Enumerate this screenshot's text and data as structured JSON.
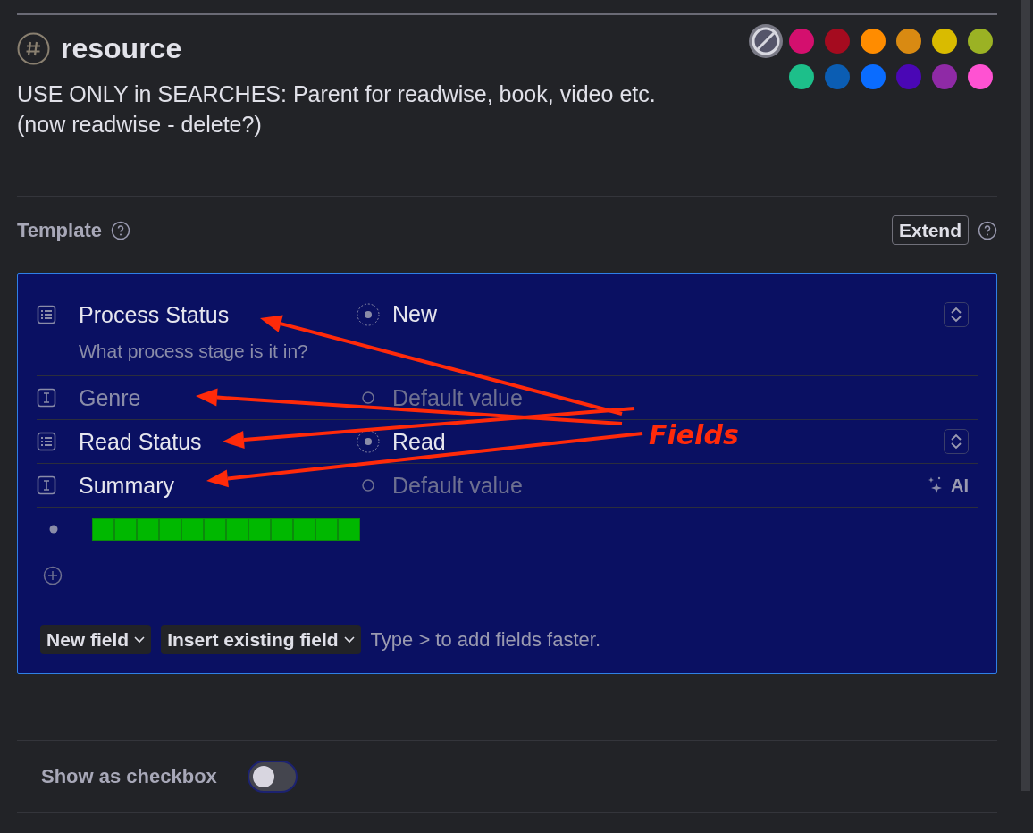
{
  "tag": {
    "name": "resource",
    "description_lines": [
      "USE ONLY in SEARCHES: Parent for readwise, book, video etc.",
      "(now readwise - delete?)"
    ]
  },
  "palette": {
    "no_color": {
      "selected": true
    },
    "colors": [
      {
        "color": "#d40f6e",
        "selected": false
      },
      {
        "color": "#a50b1f",
        "selected": false
      },
      {
        "color": "#ff8c00",
        "selected": false
      },
      {
        "color": "#d98a12",
        "selected": false
      },
      {
        "color": "#d9bb00",
        "selected": false
      },
      {
        "color": "#9bb224",
        "selected": false
      },
      {
        "color": "#1dbf8a",
        "selected": false
      },
      {
        "color": "#0b5db3",
        "selected": false
      },
      {
        "color": "#0a6cff",
        "selected": false
      },
      {
        "color": "#4a07b5",
        "selected": false
      },
      {
        "color": "#8f2aa6",
        "selected": false
      },
      {
        "color": "#ff52d2",
        "selected": false
      }
    ]
  },
  "template": {
    "label": "Template",
    "extend_button": "Extend",
    "fields": [
      {
        "kind": "options",
        "name": "Process Status",
        "description": "What process stage is it in?",
        "value": "New",
        "disabled": false,
        "annotated": true
      },
      {
        "kind": "text",
        "name": "Genre",
        "placeholder": "Default value",
        "disabled": true,
        "annotated": true
      },
      {
        "kind": "options",
        "name": "Read Status",
        "value": "Read",
        "disabled": false,
        "annotated": true
      },
      {
        "kind": "text",
        "name": "Summary",
        "placeholder": "Default value",
        "disabled": false,
        "annotated": true,
        "action": "AI"
      }
    ],
    "buttons": [
      {
        "label": "New field"
      },
      {
        "label": "Insert existing field"
      }
    ],
    "hint": "Type > to add fields faster.",
    "annotation": "Fields"
  },
  "show_as_checkbox": {
    "label": "Show as checkbox",
    "on": false
  }
}
